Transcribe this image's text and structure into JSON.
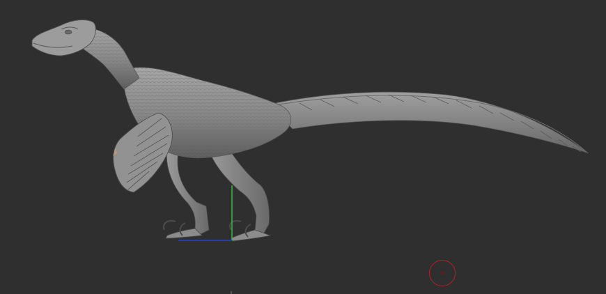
{
  "viewport": {
    "background_color": "#2f2f2f",
    "model_color": "#8a8a8a",
    "model_shadow_color": "#5a5a5a",
    "model_highlight_color": "#b4b4b4"
  },
  "gizmo": {
    "y_axis_color": "#2fbf3a",
    "x_axis_color": "#2b3fd6"
  },
  "brush_cursor": {
    "icon": "brush-circle-icon",
    "color": "#b0232a"
  }
}
